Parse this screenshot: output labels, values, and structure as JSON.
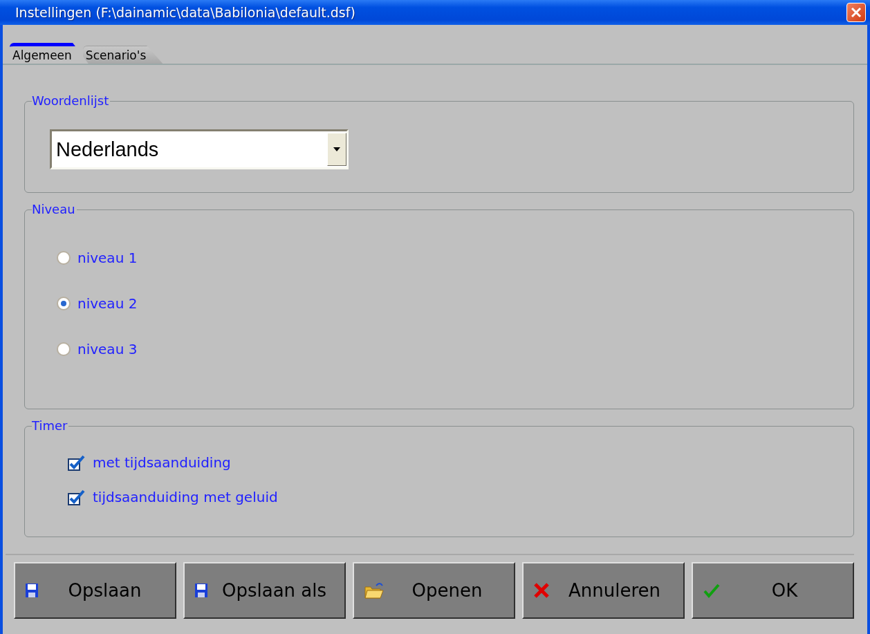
{
  "window": {
    "title": "Instellingen (F:\\dainamic\\data\\Babilonia\\default.dsf)"
  },
  "tabs": [
    {
      "label": "Algemeen",
      "selected": true
    },
    {
      "label": "Scenario's",
      "selected": false
    }
  ],
  "woordenlijst": {
    "legend": "Woordenlijst",
    "value": "Nederlands"
  },
  "niveau": {
    "legend": "Niveau",
    "options": [
      {
        "label": "niveau 1",
        "selected": false
      },
      {
        "label": "niveau 2",
        "selected": true
      },
      {
        "label": "niveau 3",
        "selected": false
      }
    ]
  },
  "timer": {
    "legend": "Timer",
    "options": [
      {
        "label": "met tijdsaanduiding",
        "checked": true
      },
      {
        "label": "tijdsaanduiding met geluid",
        "checked": true
      }
    ]
  },
  "buttons": [
    {
      "label": "Opslaan",
      "kind": "save"
    },
    {
      "label": "Opslaan als",
      "kind": "save"
    },
    {
      "label": "Openen",
      "kind": "open"
    },
    {
      "label": "Annuleren",
      "kind": "cancel"
    },
    {
      "label": "OK",
      "kind": "ok"
    }
  ]
}
